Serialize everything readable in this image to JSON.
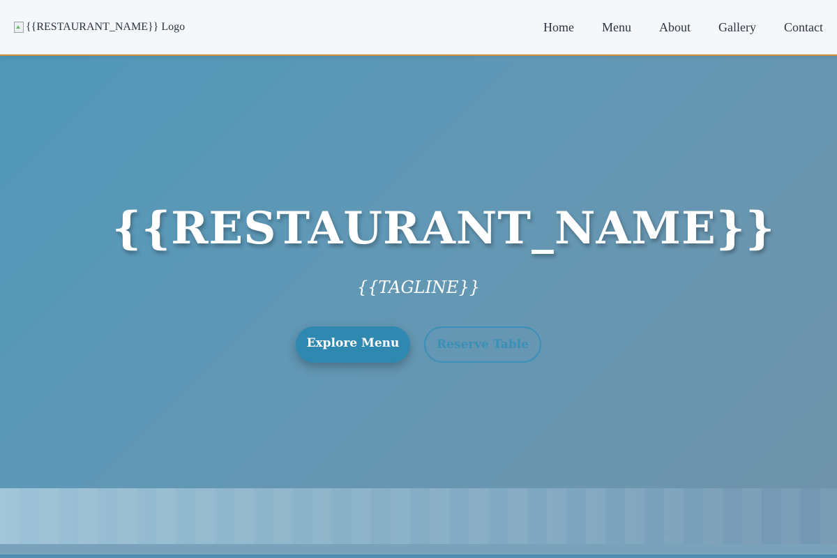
{
  "header": {
    "logo_alt": "{{RESTAURANT_NAME}} Logo",
    "nav": [
      {
        "label": "Home"
      },
      {
        "label": "Menu"
      },
      {
        "label": "About"
      },
      {
        "label": "Gallery"
      },
      {
        "label": "Contact"
      }
    ],
    "accent_color": "#d7923a"
  },
  "hero": {
    "title": "{{RESTAURANT_NAME}}",
    "tagline": "{{TAGLINE}}",
    "primary_button": "Explore Menu",
    "secondary_button": "Reserve Table",
    "primary_color": "#2e88b0"
  }
}
